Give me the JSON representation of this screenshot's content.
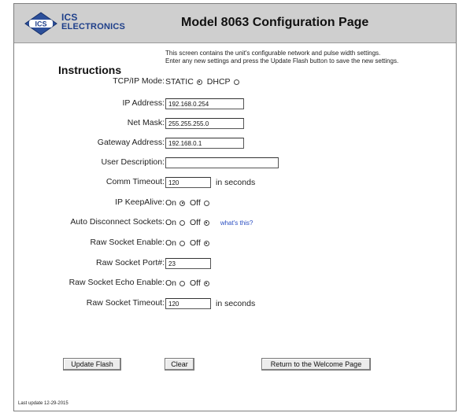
{
  "header": {
    "logo_badge": "ICS",
    "logo_line1": "ICS",
    "logo_line2": "ELECTRONICS",
    "title": "Model 8063 Configuration Page"
  },
  "instructions": {
    "heading": "Instructions",
    "text_line1": "This screen contains the unit's configurable network and pulse width settings.",
    "text_line2": "Enter any new settings and press the Update Flash button to save the new settings."
  },
  "form": {
    "tcpip_mode": {
      "label": "TCP/IP Mode:",
      "opt1": "STATIC",
      "opt2": "DHCP",
      "selected": "STATIC"
    },
    "ip_address": {
      "label": "IP Address:",
      "value": "192.168.0.254"
    },
    "net_mask": {
      "label": "Net Mask:",
      "value": "255.255.255.0"
    },
    "gateway": {
      "label": "Gateway Address:",
      "value": "192.168.0.1"
    },
    "user_description": {
      "label": "User Description:",
      "value": ""
    },
    "comm_timeout": {
      "label": "Comm Timeout:",
      "value": "120",
      "unit": "in seconds"
    },
    "ip_keepalive": {
      "label": "IP KeepAlive:",
      "opt1": "On",
      "opt2": "Off",
      "selected": "On"
    },
    "auto_disconnect": {
      "label": "Auto Disconnect Sockets:",
      "opt1": "On",
      "opt2": "Off",
      "selected": "Off",
      "help_link": "what's this?"
    },
    "raw_socket_enable": {
      "label": "Raw Socket Enable:",
      "opt1": "On",
      "opt2": "Off",
      "selected": "Off"
    },
    "raw_socket_port": {
      "label": "Raw Socket Port#:",
      "value": "23"
    },
    "raw_socket_echo": {
      "label": "Raw Socket Echo Enable:",
      "opt1": "On",
      "opt2": "Off",
      "selected": "Off"
    },
    "raw_socket_timeout": {
      "label": "Raw Socket Timeout:",
      "value": "120",
      "unit": "in seconds"
    }
  },
  "buttons": {
    "update": "Update Flash",
    "clear": "Clear",
    "return": "Return to the Welcome Page"
  },
  "footer": {
    "last_update": "Last update 12-29-2015"
  }
}
